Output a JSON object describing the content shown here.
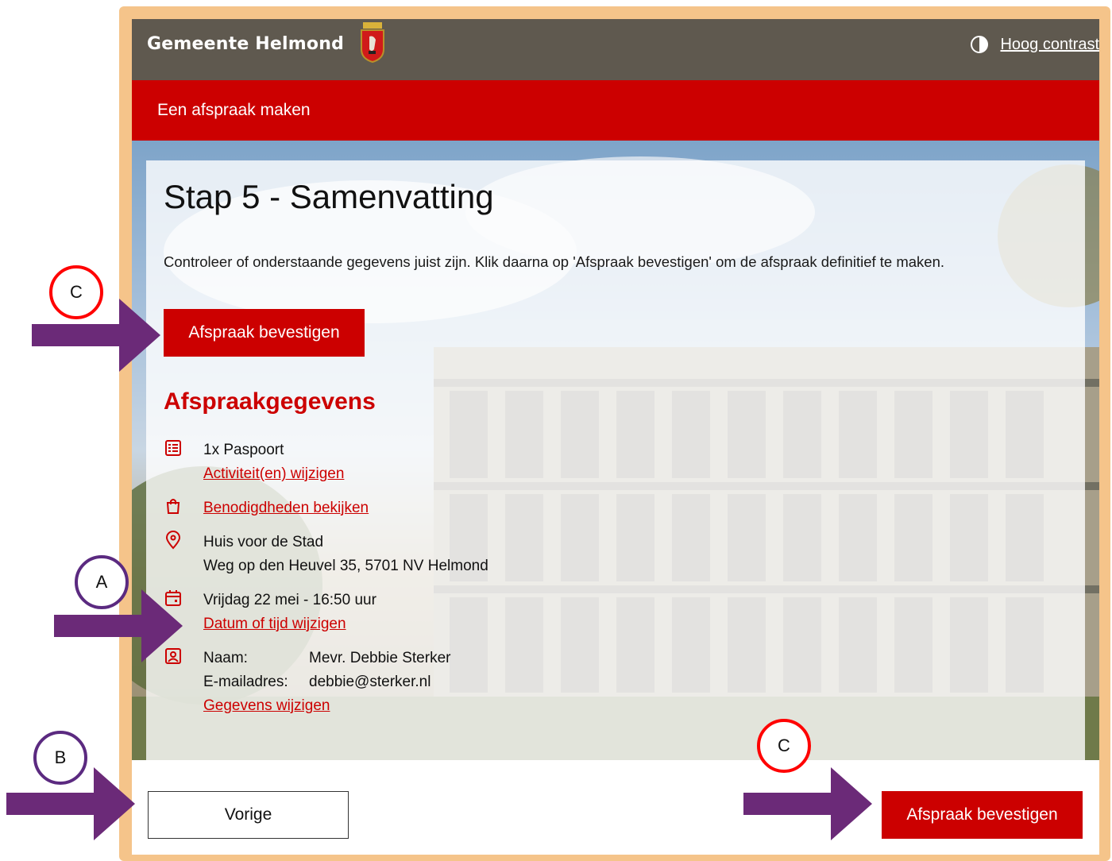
{
  "header": {
    "brand": "Gemeente Helmond",
    "contrast_label": "Hoog contrast"
  },
  "banner": {
    "title": "Een afspraak maken"
  },
  "page": {
    "title": "Stap 5 - Samenvatting",
    "intro": "Controleer of onderstaande gegevens juist zijn. Klik daarna op 'Afspraak bevestigen' om de afspraak definitief te maken.",
    "confirm_label": "Afspraak bevestigen",
    "section_title": "Afspraakgegevens"
  },
  "details": {
    "activity": "1x Paspoort",
    "activity_link": "Activiteit(en) wijzigen",
    "requirements_link": "Benodigdheden bekijken",
    "location_name": "Huis voor de Stad",
    "location_address": "Weg op den Heuvel 35, 5701 NV Helmond",
    "datetime": "Vrijdag 22 mei - 16:50 uur",
    "datetime_link": "Datum of tijd wijzigen",
    "name_label": "Naam:",
    "name_value": "Mevr. Debbie Sterker",
    "email_label": "E-mailadres:",
    "email_value": "debbie@sterker.nl",
    "personal_link": "Gegevens wijzigen"
  },
  "footer": {
    "previous_label": "Vorige",
    "confirm_label": "Afspraak bevestigen"
  },
  "annotations": {
    "a": "A",
    "b": "B",
    "c_top": "C",
    "c_bottom": "C"
  },
  "colors": {
    "header_bg": "#5f594f",
    "accent_red": "#cc0000",
    "frame_orange": "#f5c48a",
    "arrow_purple": "#6b2a78",
    "circle_red": "#ff0000"
  }
}
